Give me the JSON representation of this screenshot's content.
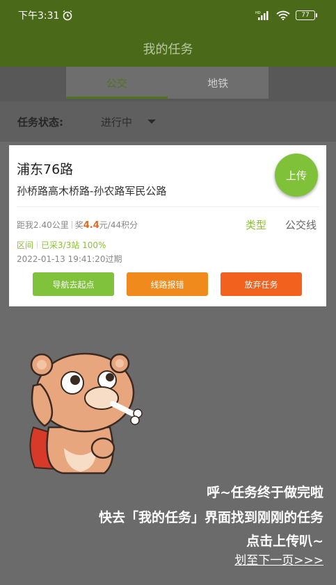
{
  "status_bar": {
    "time": "下午3:31",
    "signal": "HD",
    "battery": "77"
  },
  "header": {
    "title": "我的任务"
  },
  "tabs": [
    {
      "label": "公交",
      "active": true
    },
    {
      "label": "地铁",
      "active": false
    }
  ],
  "filter": {
    "label": "任务状态:",
    "value": "进行中"
  },
  "task": {
    "route_name": "浦东76路",
    "route_path": "孙桥路高木桥路-孙农路军民公路",
    "upload_label": "上传",
    "distance": "距我2.40公里",
    "reward_prefix": "奖",
    "reward_amount": "4.4",
    "reward_suffix": "元/44积分",
    "type_label": "类型",
    "type_value": "公交线",
    "section_label": "区间",
    "progress": "已采3/3站 100%",
    "expire": "2022-01-13 19:41:20过期",
    "buttons": {
      "navigate": "导航去起点",
      "report": "线路报错",
      "abandon": "放弃任务"
    }
  },
  "guide": {
    "line1": "呼~任务终于做完啦",
    "line2": "快去「我的任务」界面找到刚刚的任务",
    "line3": "点击上传叭~",
    "next": "划至下一页>>>"
  },
  "colors": {
    "header": "#4a6a1a",
    "accent_green": "#80c23c",
    "orange": "#f08a1c",
    "red_orange": "#f3611f"
  }
}
